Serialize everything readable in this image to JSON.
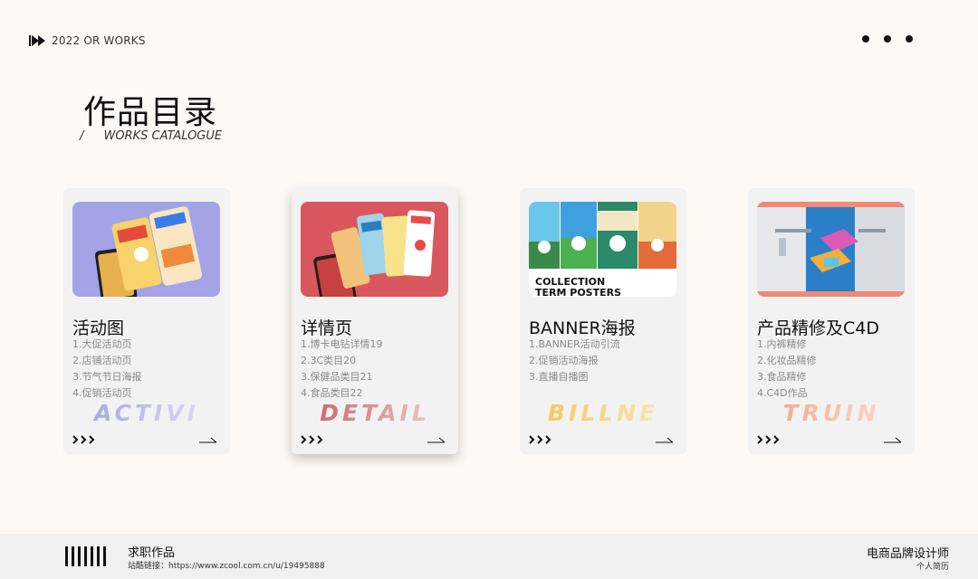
{
  "header": {
    "year_label": "2022 OR WORKS",
    "title": "作品目录",
    "subtitle_slash": "/",
    "subtitle": "WORKS CATALOGUE"
  },
  "cards": [
    {
      "heading": "活动图",
      "items": [
        "1.大促活动页",
        "2.店铺活动页",
        "3.节气节日海报",
        "4.促销活动页"
      ],
      "watermark": "ACTIVI"
    },
    {
      "heading": "详情页",
      "items": [
        "1.博卡电钻详情19",
        "2.3C类目20",
        "3.保健品类目21",
        "4.食品类目22"
      ],
      "watermark": "DETAIL"
    },
    {
      "heading": "BANNER海报",
      "items": [
        "1.BANNER活动引流",
        "2.促销活动海报",
        "3.直播自播图"
      ],
      "watermark": "BILLNE",
      "poster_caption_1": "COLLECTION",
      "poster_caption_2": "TERM POSTERS"
    },
    {
      "heading": "产品精修及C4D",
      "items": [
        "1.内裤精修",
        "2.化妆品精修",
        "3.食品精修",
        "4.C4D作品"
      ],
      "watermark": "TRUIN"
    }
  ],
  "footer": {
    "title": "求职作品",
    "link": "站酷链接：https://www.zcool.com.cn/u/19495888",
    "role": "电商品牌设计师",
    "resume": "个人简历"
  },
  "colors": {
    "background": "#fdfaf5",
    "card": "#f2f2f2",
    "card1_image": "#a3a3e6",
    "card2_image": "#d9575e",
    "card3_watermark": "#f5c24a",
    "card4_watermark": "#f2a080"
  }
}
